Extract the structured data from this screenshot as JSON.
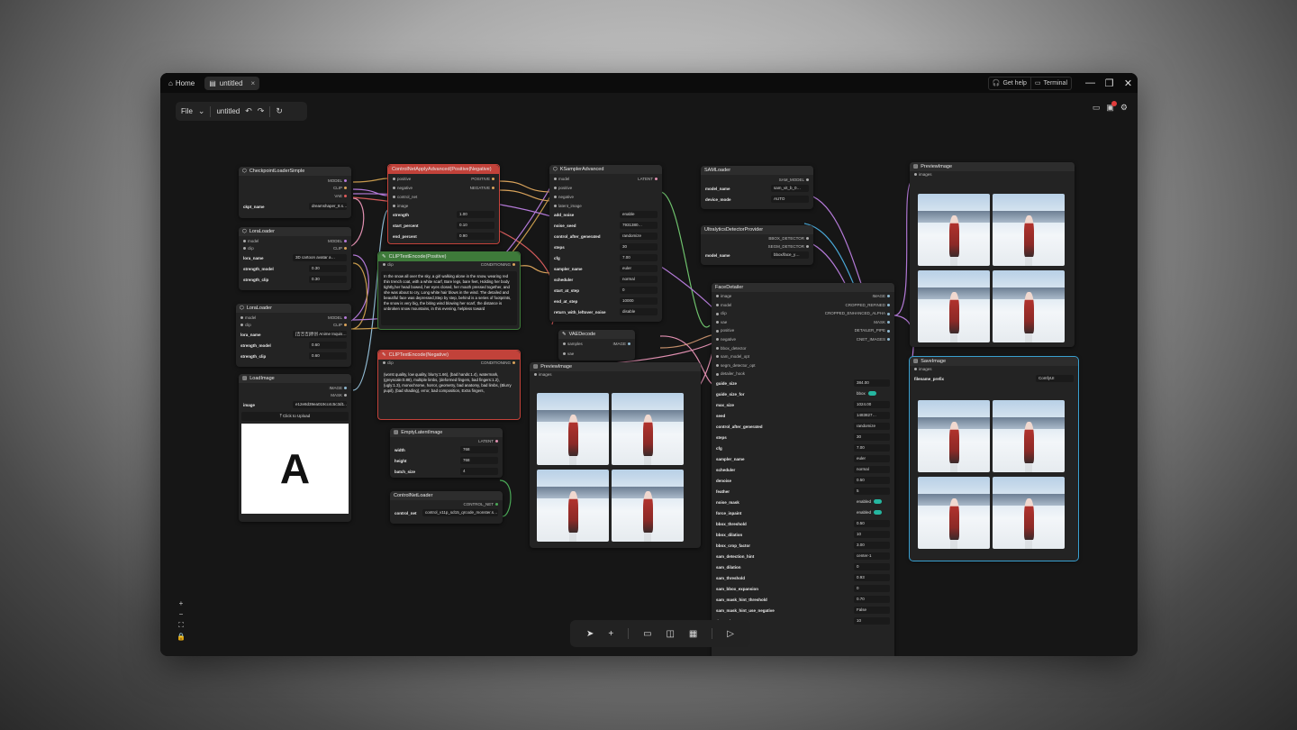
{
  "titlebar": {
    "home_label": "Home",
    "tab_label": "untitled",
    "tab_close": "×",
    "get_help": "Get help",
    "terminal": "Terminal"
  },
  "menu": {
    "file": "File",
    "workflow_name": "untitled"
  },
  "nodes": {
    "checkpoint": {
      "title": "CheckpointLoaderSimple",
      "out_model": "MODEL",
      "out_clip": "CLIP",
      "out_vae": "VAE",
      "ckpt_key": "ckpt_name",
      "ckpt_val": "dreamshaper_8.s…"
    },
    "lora1": {
      "title": "LoraLoader",
      "in_model": "model",
      "in_clip": "clip",
      "out_model": "MODEL",
      "out_clip": "CLIP",
      "lora_key": "lora_name",
      "lora_val": "3D cartoon avatar a…",
      "sm_key": "strength_model",
      "sm_val": "0.30",
      "sc_key": "strength_clip",
      "sc_val": "0.30"
    },
    "lora2": {
      "title": "LoraLoader",
      "in_model": "model",
      "in_clip": "clip",
      "out_model": "MODEL",
      "out_clip": "CLIP",
      "lora_key": "lora_name",
      "lora_val": "[吉吉吉]原创 Anime Inquis…",
      "sm_key": "strength_model",
      "sm_val": "0.60",
      "sc_key": "strength_clip",
      "sc_val": "0.60"
    },
    "loadimage": {
      "title": "LoadImage",
      "out_image": "IMAGE",
      "out_mask": "MASK",
      "image_key": "image",
      "image_val": "e12e8d39ea019cc4c5c3d1…",
      "upload": "Click to Upload",
      "preview_letter": "A"
    },
    "controlnet": {
      "title": "ControlNetApplyAdvanced(Positive|Negative)",
      "in_positive": "positive",
      "in_negative": "negative",
      "in_cn": "control_net",
      "in_image": "image",
      "out_pos": "POSITIVE",
      "out_neg": "NEGATIVE",
      "strength_key": "strength",
      "strength_val": "1.00",
      "start_key": "start_percent",
      "start_val": "0.10",
      "end_key": "end_percent",
      "end_val": "0.90"
    },
    "clip_pos": {
      "title": "CLIPTextEncode(Positive)",
      "in_clip": "clip",
      "out": "CONDITIONING",
      "text": "In the snow all over the sky, a girl walking alone in the snow, wearing red thin trench coat, with a white scarf, Bare legs, bare feet, Holding her body tightly,her head bowed, her eyes closed, her mouth pressed together, and she was about to cry, Long white hair blows in the wind. The detailed and beautiful face was depressed,Step by step, behind is a series of footprints, the snow is very big, the biting wind blowing her scarf, the distance is unbroken snow mountains, in this evening, helpless toward"
    },
    "clip_neg": {
      "title": "CLIPTextEncode(Negative)",
      "in_clip": "clip",
      "out": "CONDITIONING",
      "text": "(worst quality, low quality, blurry:1.66), (bad hands:1.4), watermark, (greyscale:0.88), multiple limbs, (deformed fingers, bad fingers:1.2), (ugly:1.3), monochrome, horror, geometry, bad anatomy, bad limbs, (Blurry pupil), (bad shading), error, bad composition, Extra fingers,"
    },
    "empty_latent": {
      "title": "EmptyLatentImage",
      "out": "LATENT",
      "w_key": "width",
      "w_val": "768",
      "h_key": "height",
      "h_val": "768",
      "b_key": "batch_size",
      "b_val": "4"
    },
    "cn_loader": {
      "title": "ControlNetLoader",
      "out": "CONTROL_NET",
      "key": "control_net",
      "val": "control_v11p_sd15_qrcode_monster.s…"
    },
    "ksampler": {
      "title": "KSamplerAdvanced",
      "in_model": "model",
      "in_pos": "positive",
      "in_neg": "negative",
      "in_latent": "latent_image",
      "out": "LATENT",
      "rows": [
        {
          "k": "add_noise",
          "v": "enable"
        },
        {
          "k": "noise_seed",
          "v": "7931380…"
        },
        {
          "k": "control_after_generated",
          "v": "randomize"
        },
        {
          "k": "steps",
          "v": "30"
        },
        {
          "k": "cfg",
          "v": "7.00"
        },
        {
          "k": "sampler_name",
          "v": "euler"
        },
        {
          "k": "scheduler",
          "v": "normal"
        },
        {
          "k": "start_at_step",
          "v": "0"
        },
        {
          "k": "end_at_step",
          "v": "10000"
        },
        {
          "k": "return_with_leftover_noise",
          "v": "disable"
        }
      ]
    },
    "vaedecode": {
      "title": "VAEDecode",
      "in_samples": "samples",
      "in_vae": "vae",
      "out": "IMAGE"
    },
    "preview_mid": {
      "title": "PreviewImage",
      "in_images": "images"
    },
    "samloader": {
      "title": "SAMLoader",
      "out": "SAM_MODEL",
      "k1": "model_name",
      "v1": "sam_vit_b_0…",
      "k2": "device_mode",
      "v2": "AUTO"
    },
    "ultra": {
      "title": "UltralyticsDetectorProvider",
      "out1": "BBOX_DETECTOR",
      "out2": "SEGM_DETECTOR",
      "k": "model_name",
      "v": "bbox/face_y…"
    },
    "facedetailer": {
      "title": "FaceDetailer",
      "inputs": [
        "image",
        "model",
        "clip",
        "vae",
        "positive",
        "negative",
        "bbox_detector",
        "sam_model_opt",
        "segm_detector_opt",
        "detailer_hook"
      ],
      "outputs": [
        "IMAGE",
        "CROPPED_REFINED",
        "CROPPED_ENHANCED_ALPHA",
        "MASK",
        "DETAILER_PIPE",
        "CNET_IMAGES"
      ],
      "rows": [
        {
          "k": "guide_size",
          "v": "384.00"
        },
        {
          "k": "guide_size_for",
          "v": "bbox"
        },
        {
          "k": "max_size",
          "v": "1024.00"
        },
        {
          "k": "seed",
          "v": "1483827…"
        },
        {
          "k": "control_after_generated",
          "v": "randomize"
        },
        {
          "k": "steps",
          "v": "30"
        },
        {
          "k": "cfg",
          "v": "7.00"
        },
        {
          "k": "sampler_name",
          "v": "euler"
        },
        {
          "k": "scheduler",
          "v": "normal"
        },
        {
          "k": "denoise",
          "v": "0.50"
        },
        {
          "k": "feather",
          "v": "5"
        },
        {
          "k": "noise_mask",
          "v": "enabled"
        },
        {
          "k": "force_inpaint",
          "v": "enabled"
        },
        {
          "k": "bbox_threshold",
          "v": "0.50"
        },
        {
          "k": "bbox_dilation",
          "v": "10"
        },
        {
          "k": "bbox_crop_factor",
          "v": "3.00"
        },
        {
          "k": "sam_detection_hint",
          "v": "center-1"
        },
        {
          "k": "sam_dilation",
          "v": "0"
        },
        {
          "k": "sam_threshold",
          "v": "0.93"
        },
        {
          "k": "sam_bbox_expansion",
          "v": "0"
        },
        {
          "k": "sam_mask_hint_threshold",
          "v": "0.70"
        },
        {
          "k": "sam_mask_hint_use_negative",
          "v": "False"
        },
        {
          "k": "drop_size",
          "v": "10"
        }
      ]
    },
    "preview_right": {
      "title": "PreviewImage",
      "in_images": "images"
    },
    "saveimage": {
      "title": "SaveImage",
      "in_images": "images",
      "k": "filename_prefix",
      "v": "ComfyUI"
    }
  },
  "colors": {
    "accent_red": "#c2423a",
    "accent_green": "#3e7a3a",
    "selection": "#3aa0d0",
    "toggle": "#25b6a0",
    "badge": "#e03b3b"
  },
  "icons": [
    "home-icon",
    "map-icon",
    "headphones-icon",
    "terminal-icon",
    "minimize-icon",
    "restore-icon",
    "close-icon",
    "undo-icon",
    "redo-icon",
    "refresh-icon",
    "keyboard-icon",
    "queue-icon",
    "settings-icon",
    "cursor-icon",
    "plus-icon",
    "panel-icon",
    "split-icon",
    "film-icon",
    "play-icon"
  ]
}
